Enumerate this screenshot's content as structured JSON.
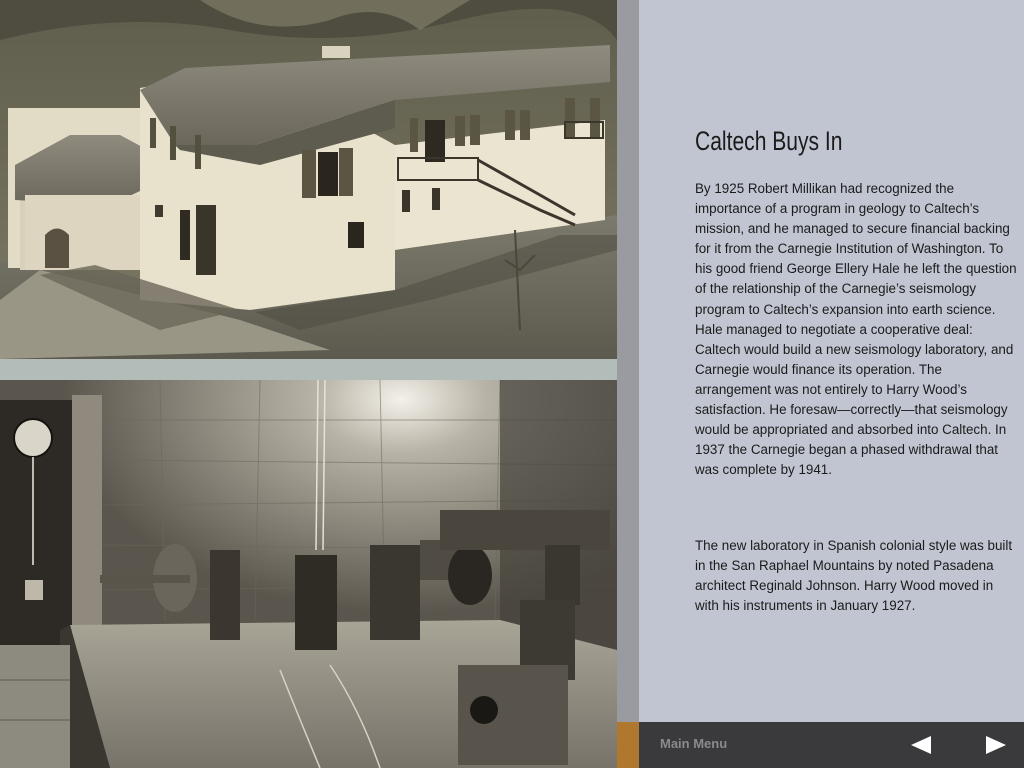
{
  "page": {
    "title": "Caltech Buys In",
    "paragraphs": [
      "By 1925 Robert Millikan had recognized the importance of a program in geology to Caltech’s mission, and he managed to secure financial backing for it from the Carnegie Institution of Washington. To his good friend George Ellery Hale he left the question of the relationship of the Carnegie’s seismology program to Caltech’s expansion into earth science. Hale managed to negotiate a cooperative deal: Caltech would build a new seismology laboratory, and Carnegie would finance its operation. The arrangement was not entirely to Harry Wood’s satisfaction. He foresaw—correctly—that seismology would be appropriated and absorbed into Caltech. In 1937 the Carnegie began a phased withdrawal that was complete by 1941.",
      "The new laboratory in Spanish colonial style was built in the San Raphael Mountains by noted Pasadena architect Reginald Johnson. Harry Wood moved in with his instruments in January 1927."
    ]
  },
  "footer": {
    "main_menu_label": "Main Menu",
    "prev_icon": "triangle-left-icon",
    "next_icon": "triangle-right-icon"
  },
  "colors": {
    "panel_bg": "#c1c5d1",
    "footer_bg": "#3a3a3c",
    "footer_accent": "#b0782e",
    "divider": "#9a9ba1"
  }
}
